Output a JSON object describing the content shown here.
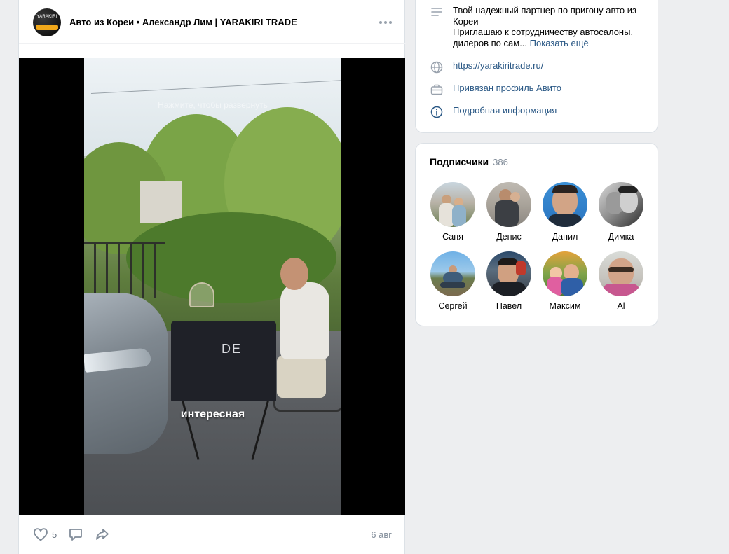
{
  "post": {
    "author": "Авто из Кореи • Александр Лим | YARAKIRI TRADE",
    "video_hint": "Нажмите, чтобы развернуть",
    "video_subtitle": "интересная",
    "table_print": "DE",
    "likes": "5",
    "date": "6 авг",
    "icons": [
      "more-icon",
      "heart-icon",
      "comment-icon",
      "share-icon"
    ]
  },
  "info": {
    "description_line1": "Твой надежный партнер по пригону авто из Кореи",
    "description_line2": "Приглашаю к сотрудничеству автосалоны, дилеров по сам...",
    "show_more": "Показать ещё",
    "website": "https://yarakiritrade.ru/",
    "avito": "Привязан профиль Авито",
    "details": "Подробная информация"
  },
  "subscribers": {
    "title": "Подписчики",
    "count": "386",
    "people": [
      {
        "name": "Саня"
      },
      {
        "name": "Денис"
      },
      {
        "name": "Данил"
      },
      {
        "name": "Димка"
      },
      {
        "name": "Сергей"
      },
      {
        "name": "Павел"
      },
      {
        "name": "Максим"
      },
      {
        "name": "Al"
      }
    ]
  },
  "colors": {
    "background": "#edeef0",
    "link": "#2a5885",
    "muted": "#818c99",
    "card": "#ffffff"
  }
}
